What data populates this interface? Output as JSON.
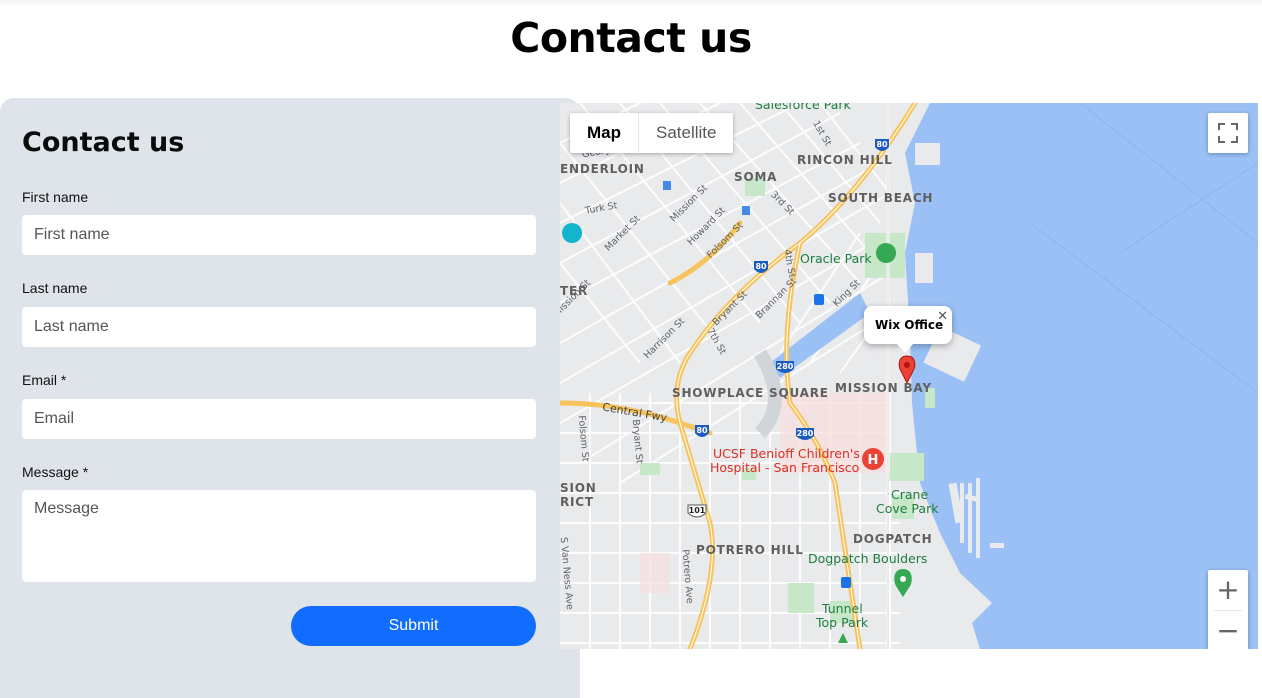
{
  "page": {
    "title": "Contact us"
  },
  "form": {
    "title": "Contact us",
    "fields": [
      {
        "label": "First name",
        "placeholder": "First name"
      },
      {
        "label": "Last name",
        "placeholder": "Last name"
      },
      {
        "label": "Email *",
        "placeholder": "Email"
      },
      {
        "label": "Message *",
        "placeholder": "Message"
      }
    ],
    "submit_label": "Submit"
  },
  "map": {
    "type_controls": {
      "map": "Map",
      "satellite": "Satellite",
      "selected": "Map"
    },
    "info_window": {
      "title": "Wix Office",
      "close": "✕"
    },
    "zoom_in": "+",
    "zoom_out": "−",
    "districts": [
      "Salesforce Park",
      "RINCON HILL",
      "SOMA",
      "SOUTH BEACH",
      "ENDERLOIN",
      "TER",
      "SHOWPLACE SQUARE",
      "MISSION BAY",
      "SION",
      "RICT",
      "DOGPATCH",
      "POTRERO HILL"
    ],
    "parks": [
      "Oracle Park",
      "Crane",
      "Cove Park",
      "Dogpatch Boulders",
      "Tunnel",
      "Top Park"
    ],
    "hospital": [
      "UCSF Benioff Children's",
      "Hospital - San Francisco"
    ],
    "streets": [
      "Geary",
      "Turk St",
      "Market St",
      "Mission St",
      "Howard St",
      "Folsom St",
      "4th St",
      "3rd St",
      "1st St",
      "Bryant St",
      "Brannan St",
      "King St",
      "Harrison St",
      "7th St",
      "Central Fwy",
      "Folsom St",
      "Bryant St",
      "Potrero Ave",
      "S Van Ness Ave",
      "Mission St"
    ],
    "highway_shields": [
      "80",
      "80",
      "80",
      "280",
      "280",
      "101"
    ],
    "colors": {
      "water": "#9ac0f5",
      "land": "#e9eaec",
      "highway": "#f7c35c",
      "park": "#c6e7c8",
      "marker": "#ea4335"
    }
  }
}
